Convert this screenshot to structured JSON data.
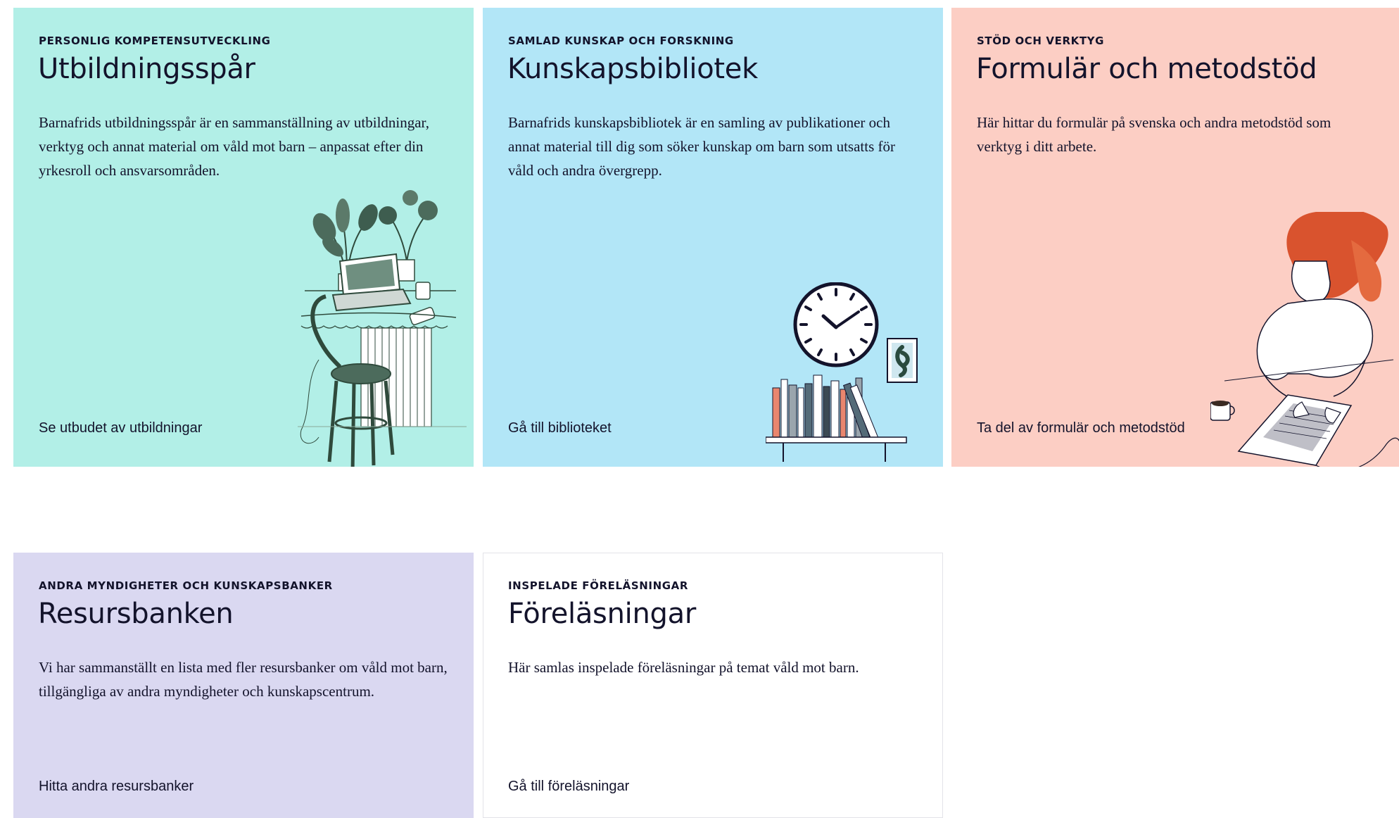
{
  "colors": {
    "mint": "#b2efe7",
    "sky": "#b2e6f7",
    "peach": "#fccec4",
    "lavender": "#dad8f1",
    "white": "#ffffff",
    "text": "#13132b"
  },
  "cards": [
    {
      "kicker": "PERSONLIG KOMPETENSUTVECKLING",
      "title": "Utbildningsspår",
      "description": "Barnafrids utbildningsspår är en sammanställning av utbildningar, verktyg och annat material om våld mot barn – anpassat efter din yrkesroll och ansvarsområden.",
      "link": "Se utbudet av utbildningar",
      "illustration": "desk-laptop-chair-illustration"
    },
    {
      "kicker": "SAMLAD KUNSKAP OCH FORSKNING",
      "title": "Kunskapsbibliotek",
      "description": "Barnafrids kunskapsbibliotek är en samling av publikationer och annat material till dig som söker kunskap om barn som utsatts för våld och andra övergrepp.",
      "link": "Gå till biblioteket",
      "illustration": "clock-bookshelf-illustration"
    },
    {
      "kicker": "STÖD OCH VERKTYG",
      "title": "Formulär och metodstöd",
      "description": "Här hittar du formulär på svenska och andra metodstöd som verktyg i ditt arbete.",
      "link": "Ta del av formulär och metodstöd",
      "illustration": "woman-laptop-illustration"
    },
    {
      "kicker": "ANDRA MYNDIGHETER OCH KUNSKAPSBANKER",
      "title": "Resursbanken",
      "description": "Vi har sammanställt en lista med fler resursbanker om våld mot barn, tillgängliga av andra myndigheter och kunskapscentrum.",
      "link": "Hitta andra resursbanker"
    },
    {
      "kicker": "INSPELADE FÖRELÄSNINGAR",
      "title": "Föreläsningar",
      "description": "Här samlas inspelade föreläsningar på temat våld mot barn.",
      "link": "Gå till föreläsningar"
    }
  ]
}
